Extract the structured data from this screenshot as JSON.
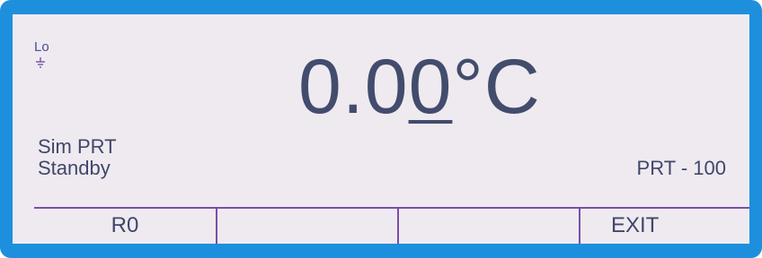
{
  "indicator": {
    "range_label": "Lo",
    "ground_icon": "ground-icon"
  },
  "reading": {
    "before_cursor": "0.0",
    "cursor_digit": "0",
    "unit": "°C"
  },
  "status": {
    "mode": "Sim PRT",
    "state": "Standby",
    "sensor": "PRT - 100"
  },
  "softkeys": [
    {
      "label": "R0"
    },
    {
      "label": ""
    },
    {
      "label": ""
    },
    {
      "label": "EXIT"
    }
  ],
  "colors": {
    "bezel": "#1e8fdc",
    "screen": "#efeaf0",
    "text": "#424c6c",
    "divider": "#7a4fa6"
  }
}
